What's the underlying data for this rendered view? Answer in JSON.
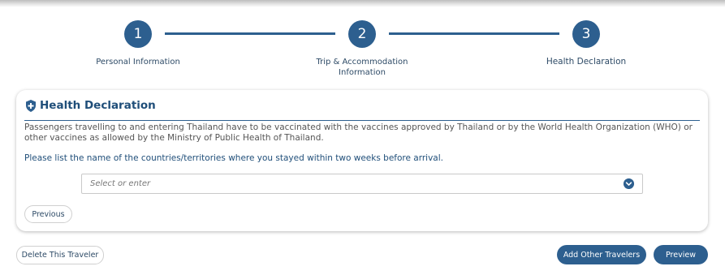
{
  "stepper": {
    "steps": [
      {
        "number": "1",
        "label": "Personal Information"
      },
      {
        "number": "2",
        "label": "Trip & Accommodation Information"
      },
      {
        "number": "3",
        "label": "Health Declaration"
      }
    ]
  },
  "card": {
    "title": "Health Declaration",
    "description": "Passengers travelling to and entering Thailand have to be vaccinated with the vaccines approved by Thailand or by the World Health Organization (WHO) or other vaccines as allowed by the Ministry of Public Health of Thailand.",
    "prompt": "Please list the name of the countries/territories where you stayed within two weeks before arrival.",
    "select_placeholder": "Select or enter",
    "previous_label": "Previous"
  },
  "footer": {
    "delete_label": "Delete This Traveler",
    "add_travelers_label": "Add Other Travelers",
    "preview_label": "Preview"
  },
  "colors": {
    "primary": "#2d5f8f"
  }
}
